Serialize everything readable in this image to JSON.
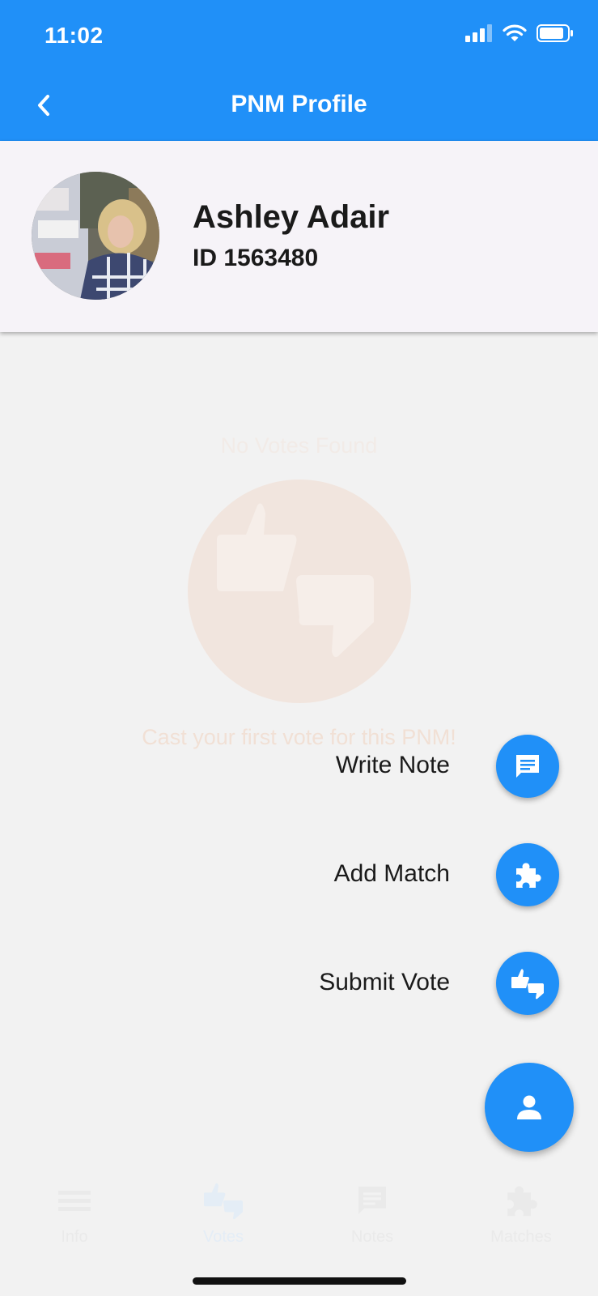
{
  "status_bar": {
    "time": "11:02"
  },
  "nav": {
    "title": "PNM Profile"
  },
  "profile": {
    "name": "Ashley Adair",
    "id_text": "ID 1563480"
  },
  "empty_state": {
    "title": "No Votes Found",
    "message": "Cast your first vote for this PNM!"
  },
  "fab_menu": {
    "items": [
      {
        "label": "Write Note",
        "icon": "note-icon"
      },
      {
        "label": "Add Match",
        "icon": "puzzle-icon"
      },
      {
        "label": "Submit Vote",
        "icon": "vote-icon"
      }
    ],
    "main_icon": "person-icon"
  },
  "tabs": [
    {
      "label": "Info",
      "icon": "list-icon"
    },
    {
      "label": "Votes",
      "icon": "vote-icon",
      "active": true
    },
    {
      "label": "Notes",
      "icon": "notes-icon"
    },
    {
      "label": "Matches",
      "icon": "puzzle-icon"
    }
  ],
  "colors": {
    "primary": "#2090f8",
    "overlay_bg": "#f2f2f2",
    "profile_bg": "#f6f3f8",
    "empty_state_tint": "#f1e5de"
  }
}
